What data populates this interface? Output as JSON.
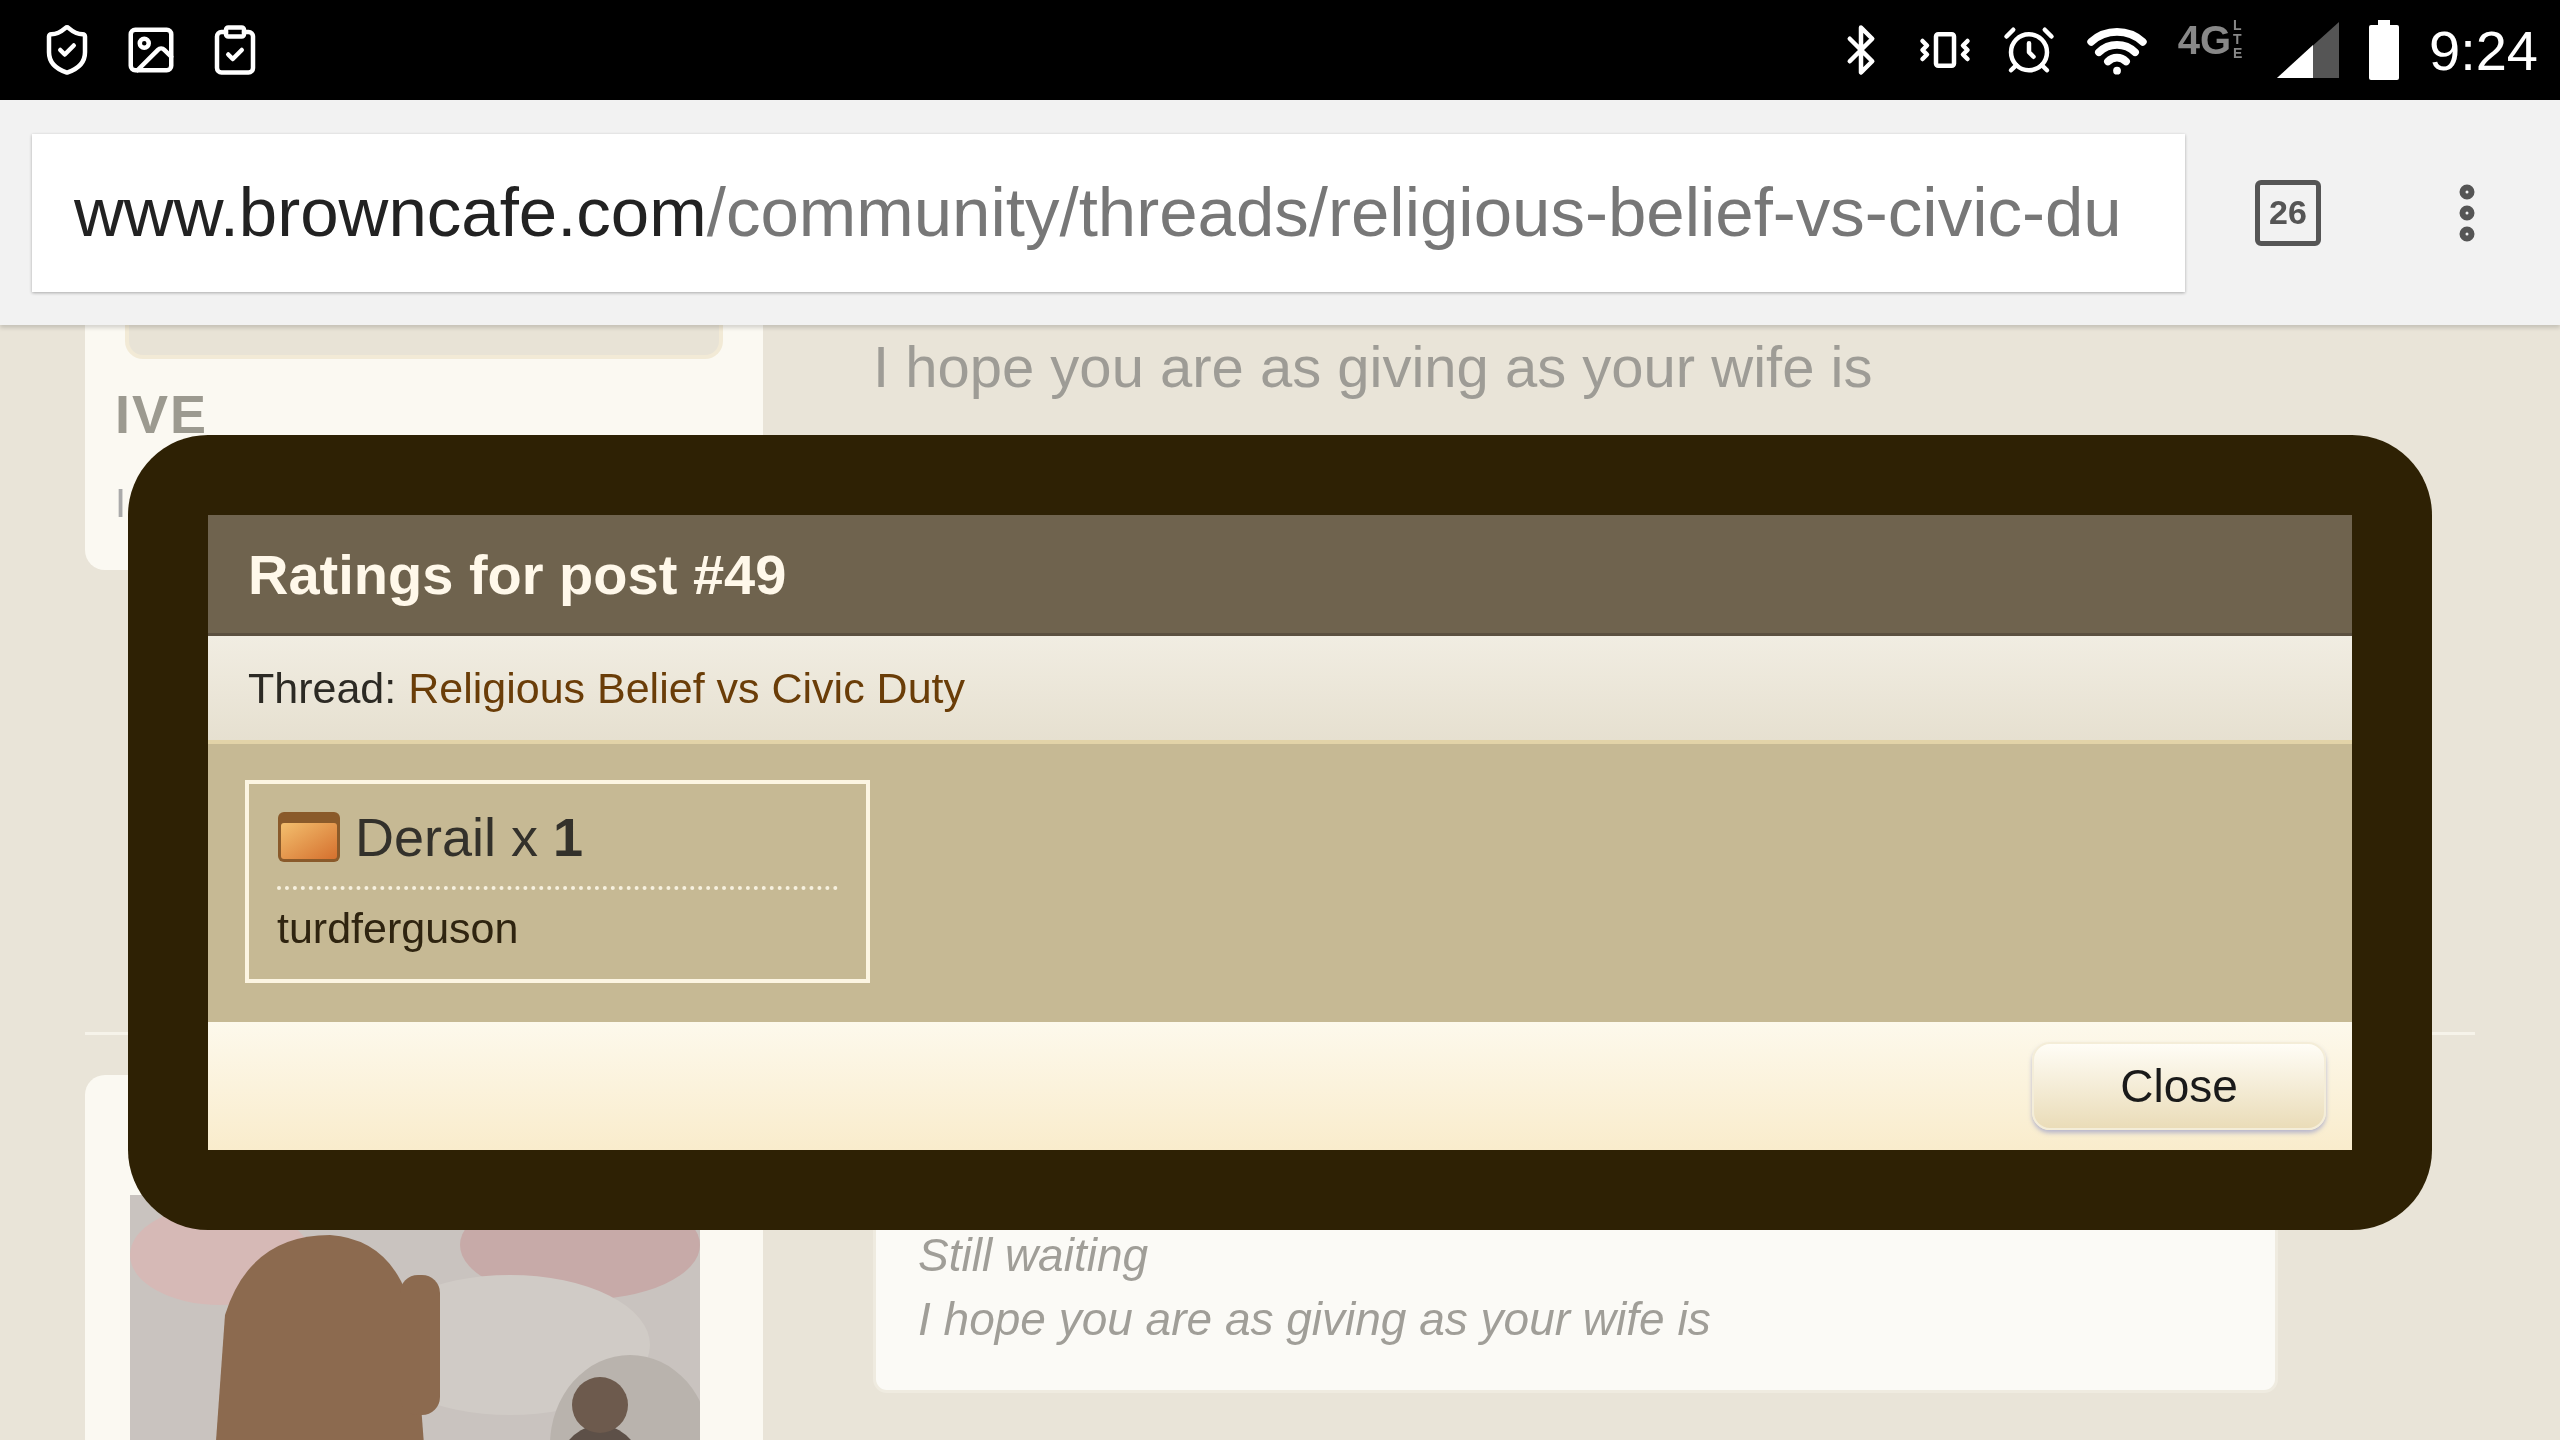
{
  "status_bar": {
    "network": "4G",
    "network_sub": "LTE",
    "time": "9:24"
  },
  "address_bar": {
    "url_host": "www.browncafe.com",
    "url_path": "/community/threads/religious-belief-vs-civic-du",
    "tab_count": "26"
  },
  "page": {
    "top_message": "I hope you are as giving as your wife is",
    "user_title": "IVE",
    "user_subtitle": "I",
    "post_lines": [
      "Still waiting",
      "I hope you are as giving as your wife is"
    ]
  },
  "dialog": {
    "title": "Ratings for post #49",
    "thread_label": "Thread:",
    "thread_link": "Religious Belief vs Civic Duty",
    "ratings": [
      {
        "label": "Derail x **1**",
        "users": [
          "turdferguson"
        ]
      }
    ],
    "buttons": [
      "Close"
    ]
  }
}
